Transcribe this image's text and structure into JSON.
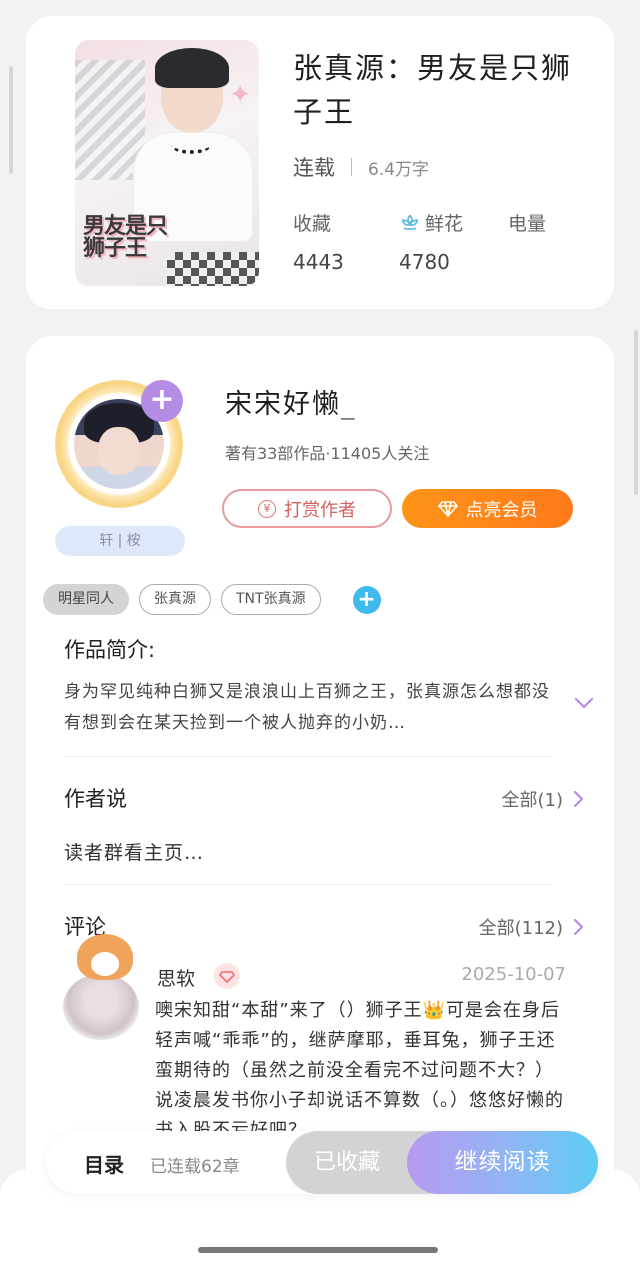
{
  "book": {
    "title": "张真源：男友是只狮子王",
    "status": "连载",
    "word_count": "6.4万字",
    "cover_title_line1": "男友是只",
    "cover_title_line2": "狮子王",
    "stats": [
      {
        "label": "收藏",
        "value": "4443"
      },
      {
        "label": "鲜花",
        "value": "4780"
      },
      {
        "label": "电量",
        "value": ""
      }
    ]
  },
  "author": {
    "name": "宋宋好懒_",
    "info": "著有33部作品·11405人关注",
    "badge": "轩 | 桉",
    "tip_button": "打赏作者",
    "tip_icon_glyph": "¥",
    "vip_button": "点亮会员"
  },
  "tags": [
    "明星同人",
    "张真源",
    "TNT张真源"
  ],
  "intro": {
    "title": "作品简介:",
    "text": "身为罕见纯种白狮又是浪浪山上百狮之王，张真源怎么想都没有想到会在某天捡到一个被人抛弃的小奶…"
  },
  "author_says": {
    "title": "作者说",
    "more": "全部(1)",
    "text": "读者群看主页…"
  },
  "comments": {
    "title": "评论",
    "more": "全部(112)",
    "items": [
      {
        "user": "思软",
        "date": "2025-10-07",
        "text": "噢宋知甜“本甜”来了（）狮子王👑可是会在身后轻声喊“乖乖”的，继萨摩耶，垂耳兔，狮子王还蛮期待的（虽然之前没全看完不过问题不大？）说凌晨发书你小子却说话不算数（。）悠悠好懒的书入股不亏好吧？"
      }
    ]
  },
  "bottom_bar": {
    "toc": "目录",
    "chapters": "已连载62章",
    "collected": "已收藏",
    "read": "继续阅读"
  },
  "colors": {
    "vip_orange": "#ff8a18",
    "tip_red": "#d65f5f",
    "read_gradient_start": "#b79af0",
    "read_gradient_end": "#5dcdf4",
    "tag_add_blue": "#3fb9ee",
    "follow_purple": "#b58ce3"
  }
}
